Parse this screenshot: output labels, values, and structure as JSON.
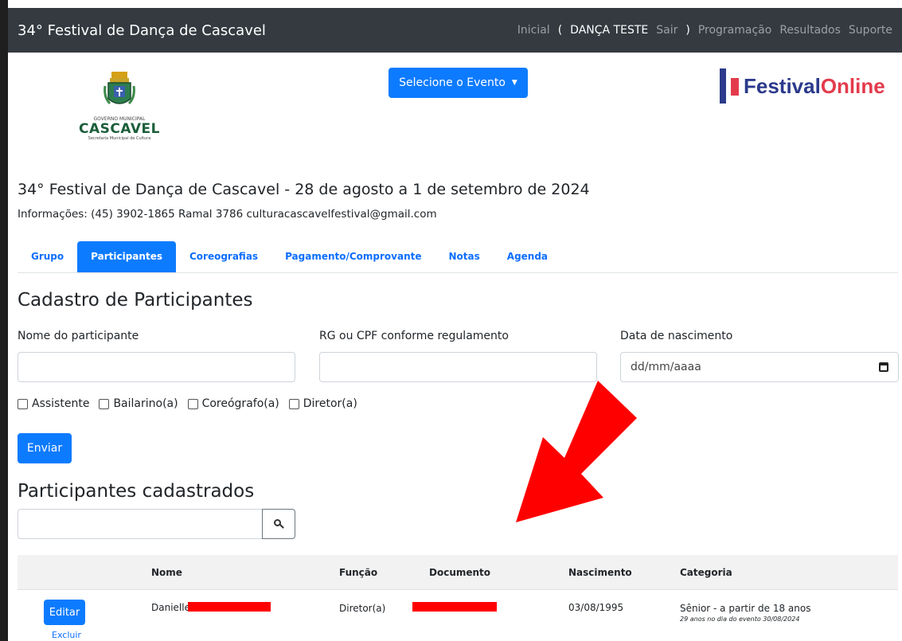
{
  "navbar": {
    "brand": "34° Festival de Dança de Cascavel",
    "inicial": "Inicial",
    "paren_open": "(",
    "user": "DANÇA TESTE",
    "sair": "Sair",
    "paren_close": ")",
    "programacao": "Programação",
    "resultados": "Resultados",
    "suporte": "Suporte"
  },
  "logo_left": {
    "gov": "GOVERNO MUNICIPAL",
    "city": "CASCAVEL",
    "secretaria": "Secretaria Municipal de Cultura"
  },
  "event_select": {
    "label": "Selecione o Evento"
  },
  "logo_right": {
    "part1": "Festival",
    "part2": "Online"
  },
  "festival": {
    "title": "34° Festival de Dança de Cascavel - 28 de agosto a 1 de setembro de 2024",
    "contact": "Informações: (45) 3902-1865 Ramal 3786 culturacascavelfestival@gmail.com"
  },
  "tabs": [
    "Grupo",
    "Participantes",
    "Coreografias",
    "Pagamento/Comprovante",
    "Notas",
    "Agenda"
  ],
  "form": {
    "title": "Cadastro de Participantes",
    "name_label": "Nome do participante",
    "doc_label": "RG ou CPF conforme regulamento",
    "birth_label": "Data de nascimento",
    "birth_placeholder": "dd/mm/aaaa",
    "checks": [
      "Assistente",
      "Bailarino(a)",
      "Coreógrafo(a)",
      "Diretor(a)"
    ],
    "submit": "Enviar"
  },
  "list": {
    "title": "Participantes cadastrados",
    "columns": [
      "Nome",
      "Função",
      "Documento",
      "Nascimento",
      "Categoria"
    ],
    "rows": [
      {
        "edit": "Editar",
        "delete": "Excluir",
        "name": "Danielle",
        "role": "Diretor(a)",
        "birth": "03/08/1995",
        "category": "Sênior - a partir de 18 anos",
        "category_note": "29 anos no dia do evento 30/08/2024"
      }
    ]
  },
  "colors": {
    "navbar": "#343a40",
    "primary": "#0d7bff",
    "annotation_arrow": "#ff0000"
  }
}
